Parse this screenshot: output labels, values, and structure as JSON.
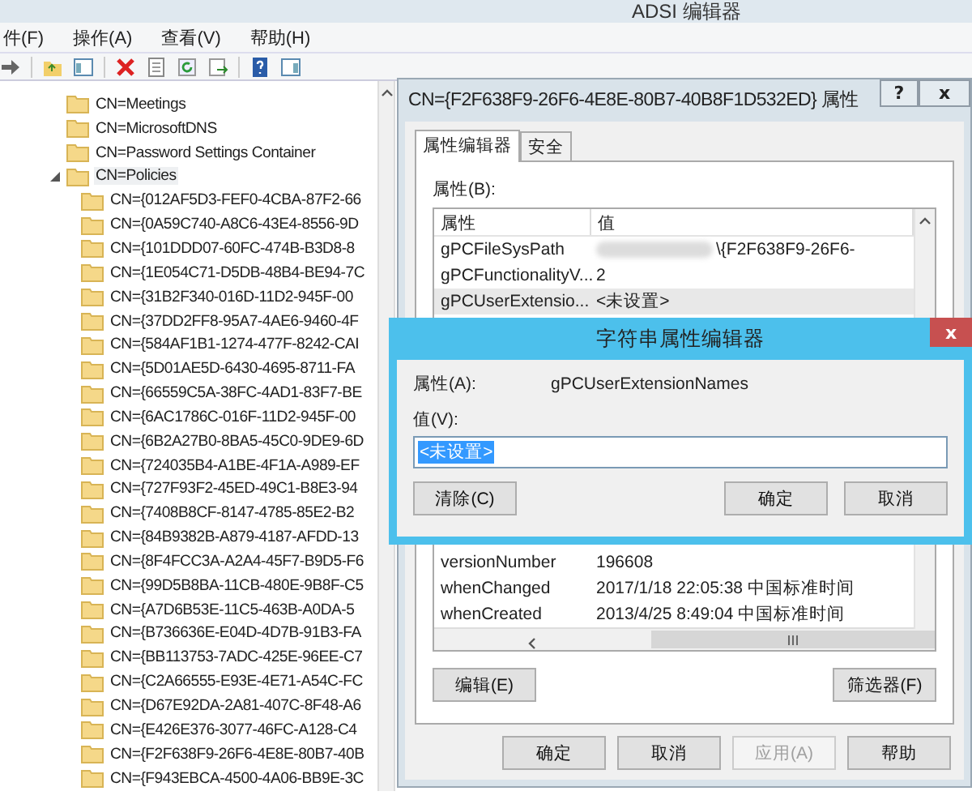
{
  "main_window": {
    "title": "ADSI 编辑器",
    "menu": [
      "件(F)",
      "操作(A)",
      "查看(V)",
      "帮助(H)"
    ],
    "tree": {
      "items": [
        {
          "label": "CN=Meetings",
          "expanded": false,
          "selected": false
        },
        {
          "label": "CN=MicrosoftDNS",
          "expanded": false,
          "selected": false
        },
        {
          "label": "CN=Password Settings Container",
          "expanded": false,
          "selected": false
        },
        {
          "label": "CN=Policies",
          "expanded": true,
          "selected": true,
          "children": [
            {
              "label": "CN={012AF5D3-FEF0-4CBA-87F2-66",
              "selected": false
            },
            {
              "label": "CN={0A59C740-A8C6-43E4-8556-9D",
              "selected": false
            },
            {
              "label": "CN={101DDD07-60FC-474B-B3D8-8",
              "selected": false
            },
            {
              "label": "CN={1E054C71-D5DB-48B4-BE94-7C",
              "selected": false
            },
            {
              "label": "CN={31B2F340-016D-11D2-945F-00",
              "selected": false
            },
            {
              "label": "CN={37DD2FF8-95A7-4AE6-9460-4F",
              "selected": false
            },
            {
              "label": "CN={584AF1B1-1274-477F-8242-CAI",
              "selected": false
            },
            {
              "label": "CN={5D01AE5D-6430-4695-8711-FA",
              "selected": false
            },
            {
              "label": "CN={66559C5A-38FC-4AD1-83F7-BE",
              "selected": false
            },
            {
              "label": "CN={6AC1786C-016F-11D2-945F-00",
              "selected": false
            },
            {
              "label": "CN={6B2A27B0-8BA5-45C0-9DE9-6D",
              "selected": false
            },
            {
              "label": "CN={724035B4-A1BE-4F1A-A989-EF",
              "selected": false
            },
            {
              "label": "CN={727F93F2-45ED-49C1-B8E3-94",
              "selected": false
            },
            {
              "label": "CN={7408B8CF-8147-4785-85E2-B2",
              "selected": false
            },
            {
              "label": "CN={84B9382B-A879-4187-AFDD-13",
              "selected": false
            },
            {
              "label": "CN={8F4FCC3A-A2A4-45F7-B9D5-F6",
              "selected": false
            },
            {
              "label": "CN={99D5B8BA-11CB-480E-9B8F-C5",
              "selected": false
            },
            {
              "label": "CN={A7D6B53E-11C5-463B-A0DA-5",
              "selected": false
            },
            {
              "label": "CN={B736636E-E04D-4D7B-91B3-FA",
              "selected": false
            },
            {
              "label": "CN={BB113753-7ADC-425E-96EE-C7",
              "selected": false
            },
            {
              "label": "CN={C2A66555-E93E-4E71-A54C-FC",
              "selected": false
            },
            {
              "label": "CN={D67E92DA-2A81-407C-8F48-A6",
              "selected": false
            },
            {
              "label": "CN={E426E376-3077-46FC-A128-C4",
              "selected": false
            },
            {
              "label": "CN={F2F638F9-26F6-4E8E-80B7-40B",
              "selected": false
            },
            {
              "label": "CN={F943EBCA-4500-4A06-BB9E-3C",
              "selected": false
            }
          ]
        }
      ]
    }
  },
  "properties_dialog": {
    "title": "CN={F2F638F9-26F6-4E8E-80B7-40B8F1D532ED} 属性",
    "help_button": "?",
    "close_button": "x",
    "tabs": [
      {
        "label": "属性编辑器",
        "selected": true
      },
      {
        "label": "安全",
        "selected": false
      }
    ],
    "attributes_label": "属性(B):",
    "table": {
      "columns": [
        "属性",
        "值"
      ],
      "rows_top": [
        {
          "name": "gPCFileSysPath",
          "value": "\\{F2F638F9-26F6-",
          "redacted": true,
          "selected": false
        },
        {
          "name": "gPCFunctionalityV...",
          "value": "2",
          "redacted": false,
          "selected": false
        },
        {
          "name": "gPCUserExtensio...",
          "value": "<未设置>",
          "redacted": false,
          "selected": true
        }
      ],
      "rows_bottom": [
        {
          "name": "versionNumber",
          "value": "196608",
          "redacted": false,
          "selected": false
        },
        {
          "name": "whenChanged",
          "value": "2017/1/18 22:05:38 中国标准时间",
          "redacted": false,
          "selected": false
        },
        {
          "name": "whenCreated",
          "value": "2013/4/25 8:49:04 中国标准时间",
          "redacted": false,
          "selected": false
        }
      ]
    },
    "edit_button": "编辑(E)",
    "filter_button": "筛选器(F)",
    "footer_buttons": [
      {
        "label": "确定",
        "disabled": false
      },
      {
        "label": "取消",
        "disabled": false
      },
      {
        "label": "应用(A)",
        "disabled": true
      },
      {
        "label": "帮助",
        "disabled": false
      }
    ]
  },
  "string_editor": {
    "title": "字符串属性编辑器",
    "close_button": "x",
    "attribute_label": "属性(A):",
    "attribute_value": "gPCUserExtensionNames",
    "value_label": "值(V):",
    "value_field": {
      "value": "<未设置>",
      "selected": true
    },
    "buttons": [
      {
        "label": "清除(C)"
      },
      {
        "label": "确定"
      },
      {
        "label": "取消"
      }
    ]
  }
}
